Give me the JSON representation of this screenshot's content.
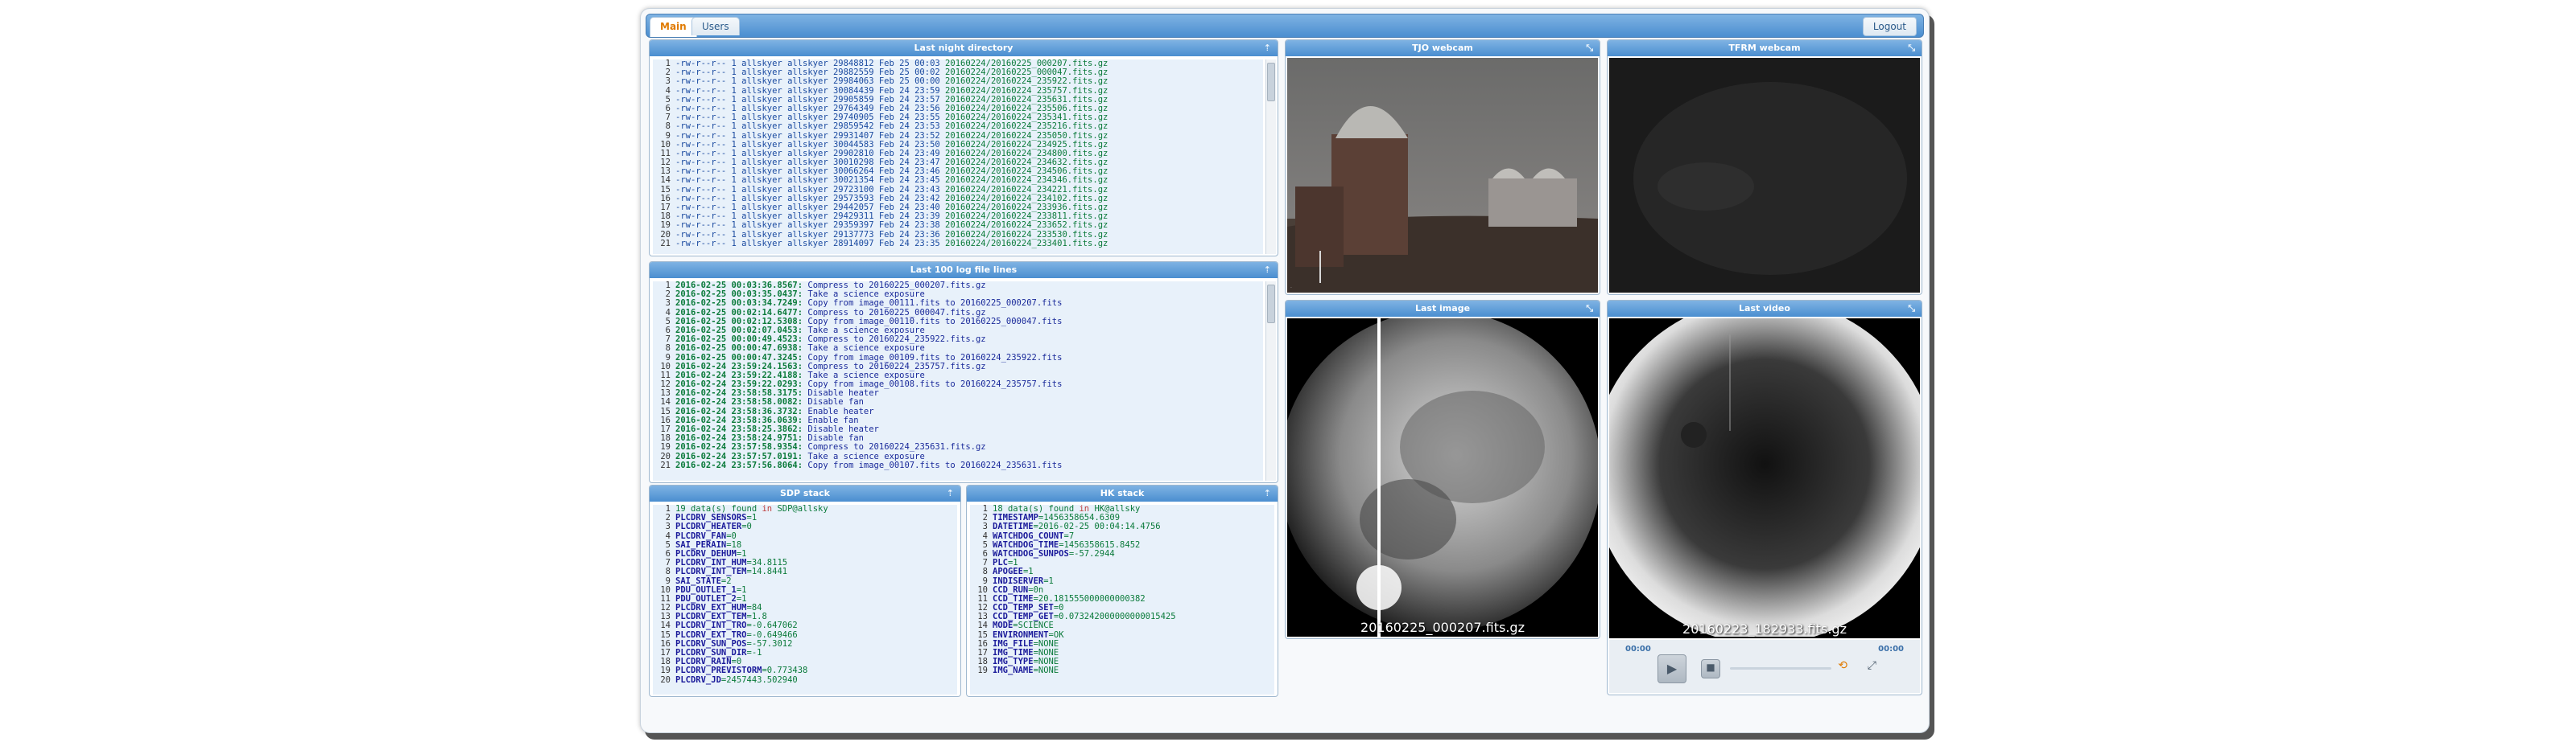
{
  "tabs": [
    {
      "label": "Main",
      "active": true
    },
    {
      "label": "Users",
      "active": false
    }
  ],
  "logout_label": "Logout",
  "panels": {
    "dir": {
      "title": "Last night directory",
      "corner": "⇡"
    },
    "log": {
      "title": "Last 100 log file lines",
      "corner": "⇡"
    },
    "sdp": {
      "title": "SDP stack",
      "corner": "⇡"
    },
    "hk": {
      "title": "HK stack",
      "corner": "⇡"
    },
    "tjo": {
      "title": "TJO webcam",
      "corner": "⤡"
    },
    "tfrm": {
      "title": "TFRM webcam",
      "corner": "⤡"
    },
    "last_image": {
      "title": "Last image",
      "corner": "⤡",
      "caption": "20160225_000207.fits.gz"
    },
    "last_video": {
      "title": "Last video",
      "corner": "⤡",
      "caption": "20160223_182933.fits.gz"
    }
  },
  "dir_lines": [
    [
      "1",
      "-rw-r--r-- 1 allskyer allskyer 29848812 Feb 25 00:03",
      "20160224/20160225_000207.fits.gz"
    ],
    [
      "2",
      "-rw-r--r-- 1 allskyer allskyer 29882559 Feb 25 00:02",
      "20160224/20160225_000047.fits.gz"
    ],
    [
      "3",
      "-rw-r--r-- 1 allskyer allskyer 29984063 Feb 25 00:00",
      "20160224/20160224_235922.fits.gz"
    ],
    [
      "4",
      "-rw-r--r-- 1 allskyer allskyer 30084439 Feb 24 23:59",
      "20160224/20160224_235757.fits.gz"
    ],
    [
      "5",
      "-rw-r--r-- 1 allskyer allskyer 29905859 Feb 24 23:57",
      "20160224/20160224_235631.fits.gz"
    ],
    [
      "6",
      "-rw-r--r-- 1 allskyer allskyer 29764349 Feb 24 23:56",
      "20160224/20160224_235506.fits.gz"
    ],
    [
      "7",
      "-rw-r--r-- 1 allskyer allskyer 29740905 Feb 24 23:55",
      "20160224/20160224_235341.fits.gz"
    ],
    [
      "8",
      "-rw-r--r-- 1 allskyer allskyer 29859542 Feb 24 23:53",
      "20160224/20160224_235216.fits.gz"
    ],
    [
      "9",
      "-rw-r--r-- 1 allskyer allskyer 29931407 Feb 24 23:52",
      "20160224/20160224_235050.fits.gz"
    ],
    [
      "10",
      "-rw-r--r-- 1 allskyer allskyer 30044583 Feb 24 23:50",
      "20160224/20160224_234925.fits.gz"
    ],
    [
      "11",
      "-rw-r--r-- 1 allskyer allskyer 29902810 Feb 24 23:49",
      "20160224/20160224_234800.fits.gz"
    ],
    [
      "12",
      "-rw-r--r-- 1 allskyer allskyer 30010298 Feb 24 23:47",
      "20160224/20160224_234632.fits.gz"
    ],
    [
      "13",
      "-rw-r--r-- 1 allskyer allskyer 30066264 Feb 24 23:46",
      "20160224/20160224_234506.fits.gz"
    ],
    [
      "14",
      "-rw-r--r-- 1 allskyer allskyer 30021354 Feb 24 23:45",
      "20160224/20160224_234346.fits.gz"
    ],
    [
      "15",
      "-rw-r--r-- 1 allskyer allskyer 29723100 Feb 24 23:43",
      "20160224/20160224_234221.fits.gz"
    ],
    [
      "16",
      "-rw-r--r-- 1 allskyer allskyer 29573593 Feb 24 23:42",
      "20160224/20160224_234102.fits.gz"
    ],
    [
      "17",
      "-rw-r--r-- 1 allskyer allskyer 29442057 Feb 24 23:40",
      "20160224/20160224_233936.fits.gz"
    ],
    [
      "18",
      "-rw-r--r-- 1 allskyer allskyer 29429311 Feb 24 23:39",
      "20160224/20160224_233811.fits.gz"
    ],
    [
      "19",
      "-rw-r--r-- 1 allskyer allskyer 29359397 Feb 24 23:38",
      "20160224/20160224_233652.fits.gz"
    ],
    [
      "20",
      "-rw-r--r-- 1 allskyer allskyer 29137773 Feb 24 23:36",
      "20160224/20160224_233530.fits.gz"
    ],
    [
      "21",
      "-rw-r--r-- 1 allskyer allskyer 28914097 Feb 24 23:35",
      "20160224/20160224_233401.fits.gz"
    ]
  ],
  "log_lines": [
    [
      "1",
      "2016-02-25 00:03:36.8567:",
      "Compress to 20160225_000207.fits.gz"
    ],
    [
      "2",
      "2016-02-25 00:03:35.0437:",
      "Take a science exposure"
    ],
    [
      "3",
      "2016-02-25 00:03:34.7249:",
      "Copy from image_00111.fits to 20160225_000207.fits"
    ],
    [
      "4",
      "2016-02-25 00:02:14.6477:",
      "Compress to 20160225_000047.fits.gz"
    ],
    [
      "5",
      "2016-02-25 00:02:12.5308:",
      "Copy from image_00110.fits to 20160225_000047.fits"
    ],
    [
      "6",
      "2016-02-25 00:02:07.0453:",
      "Take a science exposure"
    ],
    [
      "7",
      "2016-02-25 00:00:49.4523:",
      "Compress to 20160224_235922.fits.gz"
    ],
    [
      "8",
      "2016-02-25 00:00:47.6938:",
      "Take a science exposure"
    ],
    [
      "9",
      "2016-02-25 00:00:47.3245:",
      "Copy from image_00109.fits to 20160224_235922.fits"
    ],
    [
      "10",
      "2016-02-24 23:59:24.1563:",
      "Compress to 20160224_235757.fits.gz"
    ],
    [
      "11",
      "2016-02-24 23:59:22.4188:",
      "Take a science exposure"
    ],
    [
      "12",
      "2016-02-24 23:59:22.0293:",
      "Copy from image_00108.fits to 20160224_235757.fits"
    ],
    [
      "13",
      "2016-02-24 23:58:58.3175:",
      "Disable heater"
    ],
    [
      "14",
      "2016-02-24 23:58:58.0082:",
      "Disable fan"
    ],
    [
      "15",
      "2016-02-24 23:58:36.3732:",
      "Enable heater"
    ],
    [
      "16",
      "2016-02-24 23:58:36.0639:",
      "Enable fan"
    ],
    [
      "17",
      "2016-02-24 23:58:25.3862:",
      "Disable heater"
    ],
    [
      "18",
      "2016-02-24 23:58:24.9751:",
      "Disable fan"
    ],
    [
      "19",
      "2016-02-24 23:57:58.9354:",
      "Compress to 20160224_235631.fits.gz"
    ],
    [
      "20",
      "2016-02-24 23:57:57.0191:",
      "Take a science exposure"
    ],
    [
      "21",
      "2016-02-24 23:57:56.8064:",
      "Copy from image_00107.fits to 20160224_235631.fits"
    ]
  ],
  "sdp": {
    "header": [
      "19 data(s) found",
      "in",
      "SDP@allsky"
    ],
    "rows": [
      [
        "2",
        "PLCDRV_SENSORS",
        "=1"
      ],
      [
        "3",
        "PLCDRV_HEATER",
        "=0"
      ],
      [
        "4",
        "PLCDRV_FAN",
        "=0"
      ],
      [
        "5",
        "SAI_PERAIN",
        "=18"
      ],
      [
        "6",
        "PLCDRV_DEHUM",
        "=1"
      ],
      [
        "7",
        "PLCDRV_INT_HUM",
        "=34.8115"
      ],
      [
        "8",
        "PLCDRV_INT_TEM",
        "=14.8441"
      ],
      [
        "9",
        "SAI_STATE",
        "=2"
      ],
      [
        "10",
        "PDU_OUTLET_1",
        "=1"
      ],
      [
        "11",
        "PDU_OUTLET_2",
        "=1"
      ],
      [
        "12",
        "PLCDRV_EXT_HUM",
        "=84"
      ],
      [
        "13",
        "PLCDRV_EXT_TEM",
        "=1.8"
      ],
      [
        "14",
        "PLCDRV_INT_TRO",
        "=-0.647062"
      ],
      [
        "15",
        "PLCDRV_EXT_TRO",
        "=-0.649466"
      ],
      [
        "16",
        "PLCDRV_SUN_POS",
        "=-57.3012"
      ],
      [
        "17",
        "PLCDRV_SUN_DIR",
        "=-1"
      ],
      [
        "18",
        "PLCDRV_RAIN",
        "=0"
      ],
      [
        "19",
        "PLCDRV_PREVISTORM",
        "=0.773438"
      ],
      [
        "20",
        "PLCDRV_JD",
        "=2457443.502940"
      ]
    ]
  },
  "hk": {
    "header": [
      "18 data(s) found",
      "in",
      "HK@allsky"
    ],
    "rows": [
      [
        "2",
        "TIMESTAMP",
        "=1456358654.6309"
      ],
      [
        "3",
        "DATETIME",
        "=2016-02-25 00:04:14.4756"
      ],
      [
        "4",
        "WATCHDOG_COUNT",
        "=7"
      ],
      [
        "5",
        "WATCHDOG_TIME",
        "=1456358615.8452"
      ],
      [
        "6",
        "WATCHDOG_SUNPOS",
        "=-57.2944"
      ],
      [
        "7",
        "PLC",
        "=1"
      ],
      [
        "8",
        "APOGEE",
        "=1"
      ],
      [
        "9",
        "INDISERVER",
        "=1"
      ],
      [
        "10",
        "CCD_RUN",
        "=0n"
      ],
      [
        "11",
        "CCD_TIME",
        "=20.181555000000000382"
      ],
      [
        "12",
        "CCD_TEMP_SET",
        "=0"
      ],
      [
        "13",
        "CCD_TEMP_GET",
        "=0.073242000000000015425"
      ],
      [
        "14",
        "MODE",
        "=SCIENCE"
      ],
      [
        "15",
        "ENVIRONMENT",
        "=OK"
      ],
      [
        "16",
        "IMG_FILE",
        "=NONE"
      ],
      [
        "17",
        "IMG_TIME",
        "=NONE"
      ],
      [
        "18",
        "IMG_TYPE",
        "=NONE"
      ],
      [
        "19",
        "IMG_NAME",
        "=NONE"
      ]
    ]
  },
  "video": {
    "time_left": "00:00",
    "time_right": "00:00",
    "progress": 0
  },
  "icons": {
    "play": "play-icon",
    "stop": "stop-icon",
    "loop": "loop-icon",
    "fullscreen": "fullscreen-icon"
  },
  "colors": {
    "accent": "#4a8ed0",
    "active_tab": "#e07a00"
  }
}
